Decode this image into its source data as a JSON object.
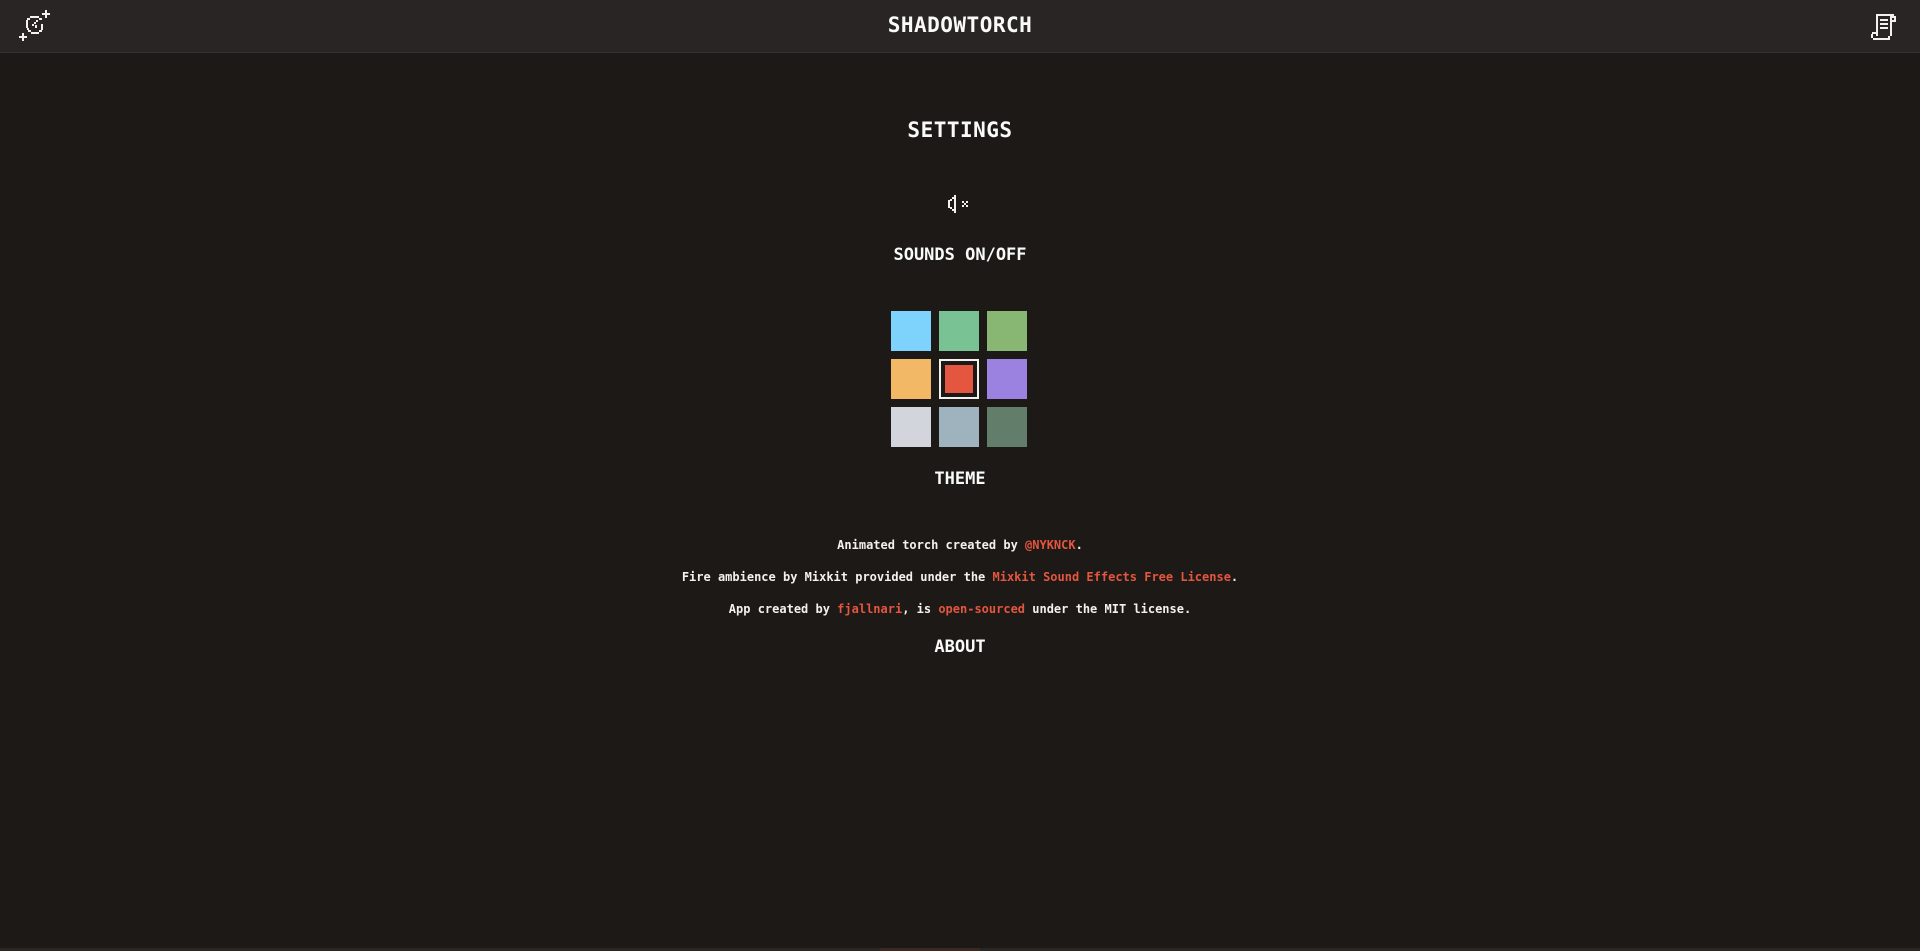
{
  "header": {
    "title": "SHADOWTORCH",
    "left_icon": "add-torch-icon",
    "right_icon": "scroll-settings-icon"
  },
  "settings": {
    "title": "SETTINGS",
    "sound_icon": "sound-off-icon",
    "sounds_label": "SOUNDS ON/OFF",
    "sounds_enabled": false
  },
  "theme": {
    "label": "THEME",
    "swatches": [
      {
        "color": "#7dd3fc",
        "selected": false
      },
      {
        "color": "#78c294",
        "selected": false
      },
      {
        "color": "#87b773",
        "selected": false
      },
      {
        "color": "#f2b866",
        "selected": false
      },
      {
        "color": "#e4563f",
        "selected": true
      },
      {
        "color": "#9b82e0",
        "selected": false
      },
      {
        "color": "#d2d5dc",
        "selected": false
      },
      {
        "color": "#9eb3bd",
        "selected": false
      },
      {
        "color": "#637d6b",
        "selected": false
      }
    ]
  },
  "about": {
    "label": "ABOUT",
    "credit1": {
      "before": "Animated torch created by ",
      "link": "@NYKNCK",
      "after": "."
    },
    "credit2": {
      "before": "Fire ambience by Mixkit provided under the ",
      "link": "Mixkit Sound Effects Free License",
      "after": "."
    },
    "credit3": {
      "before": "App created by ",
      "link1": "fjallnari",
      "middle": ", is ",
      "link2": "open-sourced",
      "after": " under the MIT license."
    }
  },
  "colors": {
    "accent": "#e4563f",
    "background": "#1c1917",
    "header_bg": "#292524",
    "text": "#f3f1ee"
  }
}
